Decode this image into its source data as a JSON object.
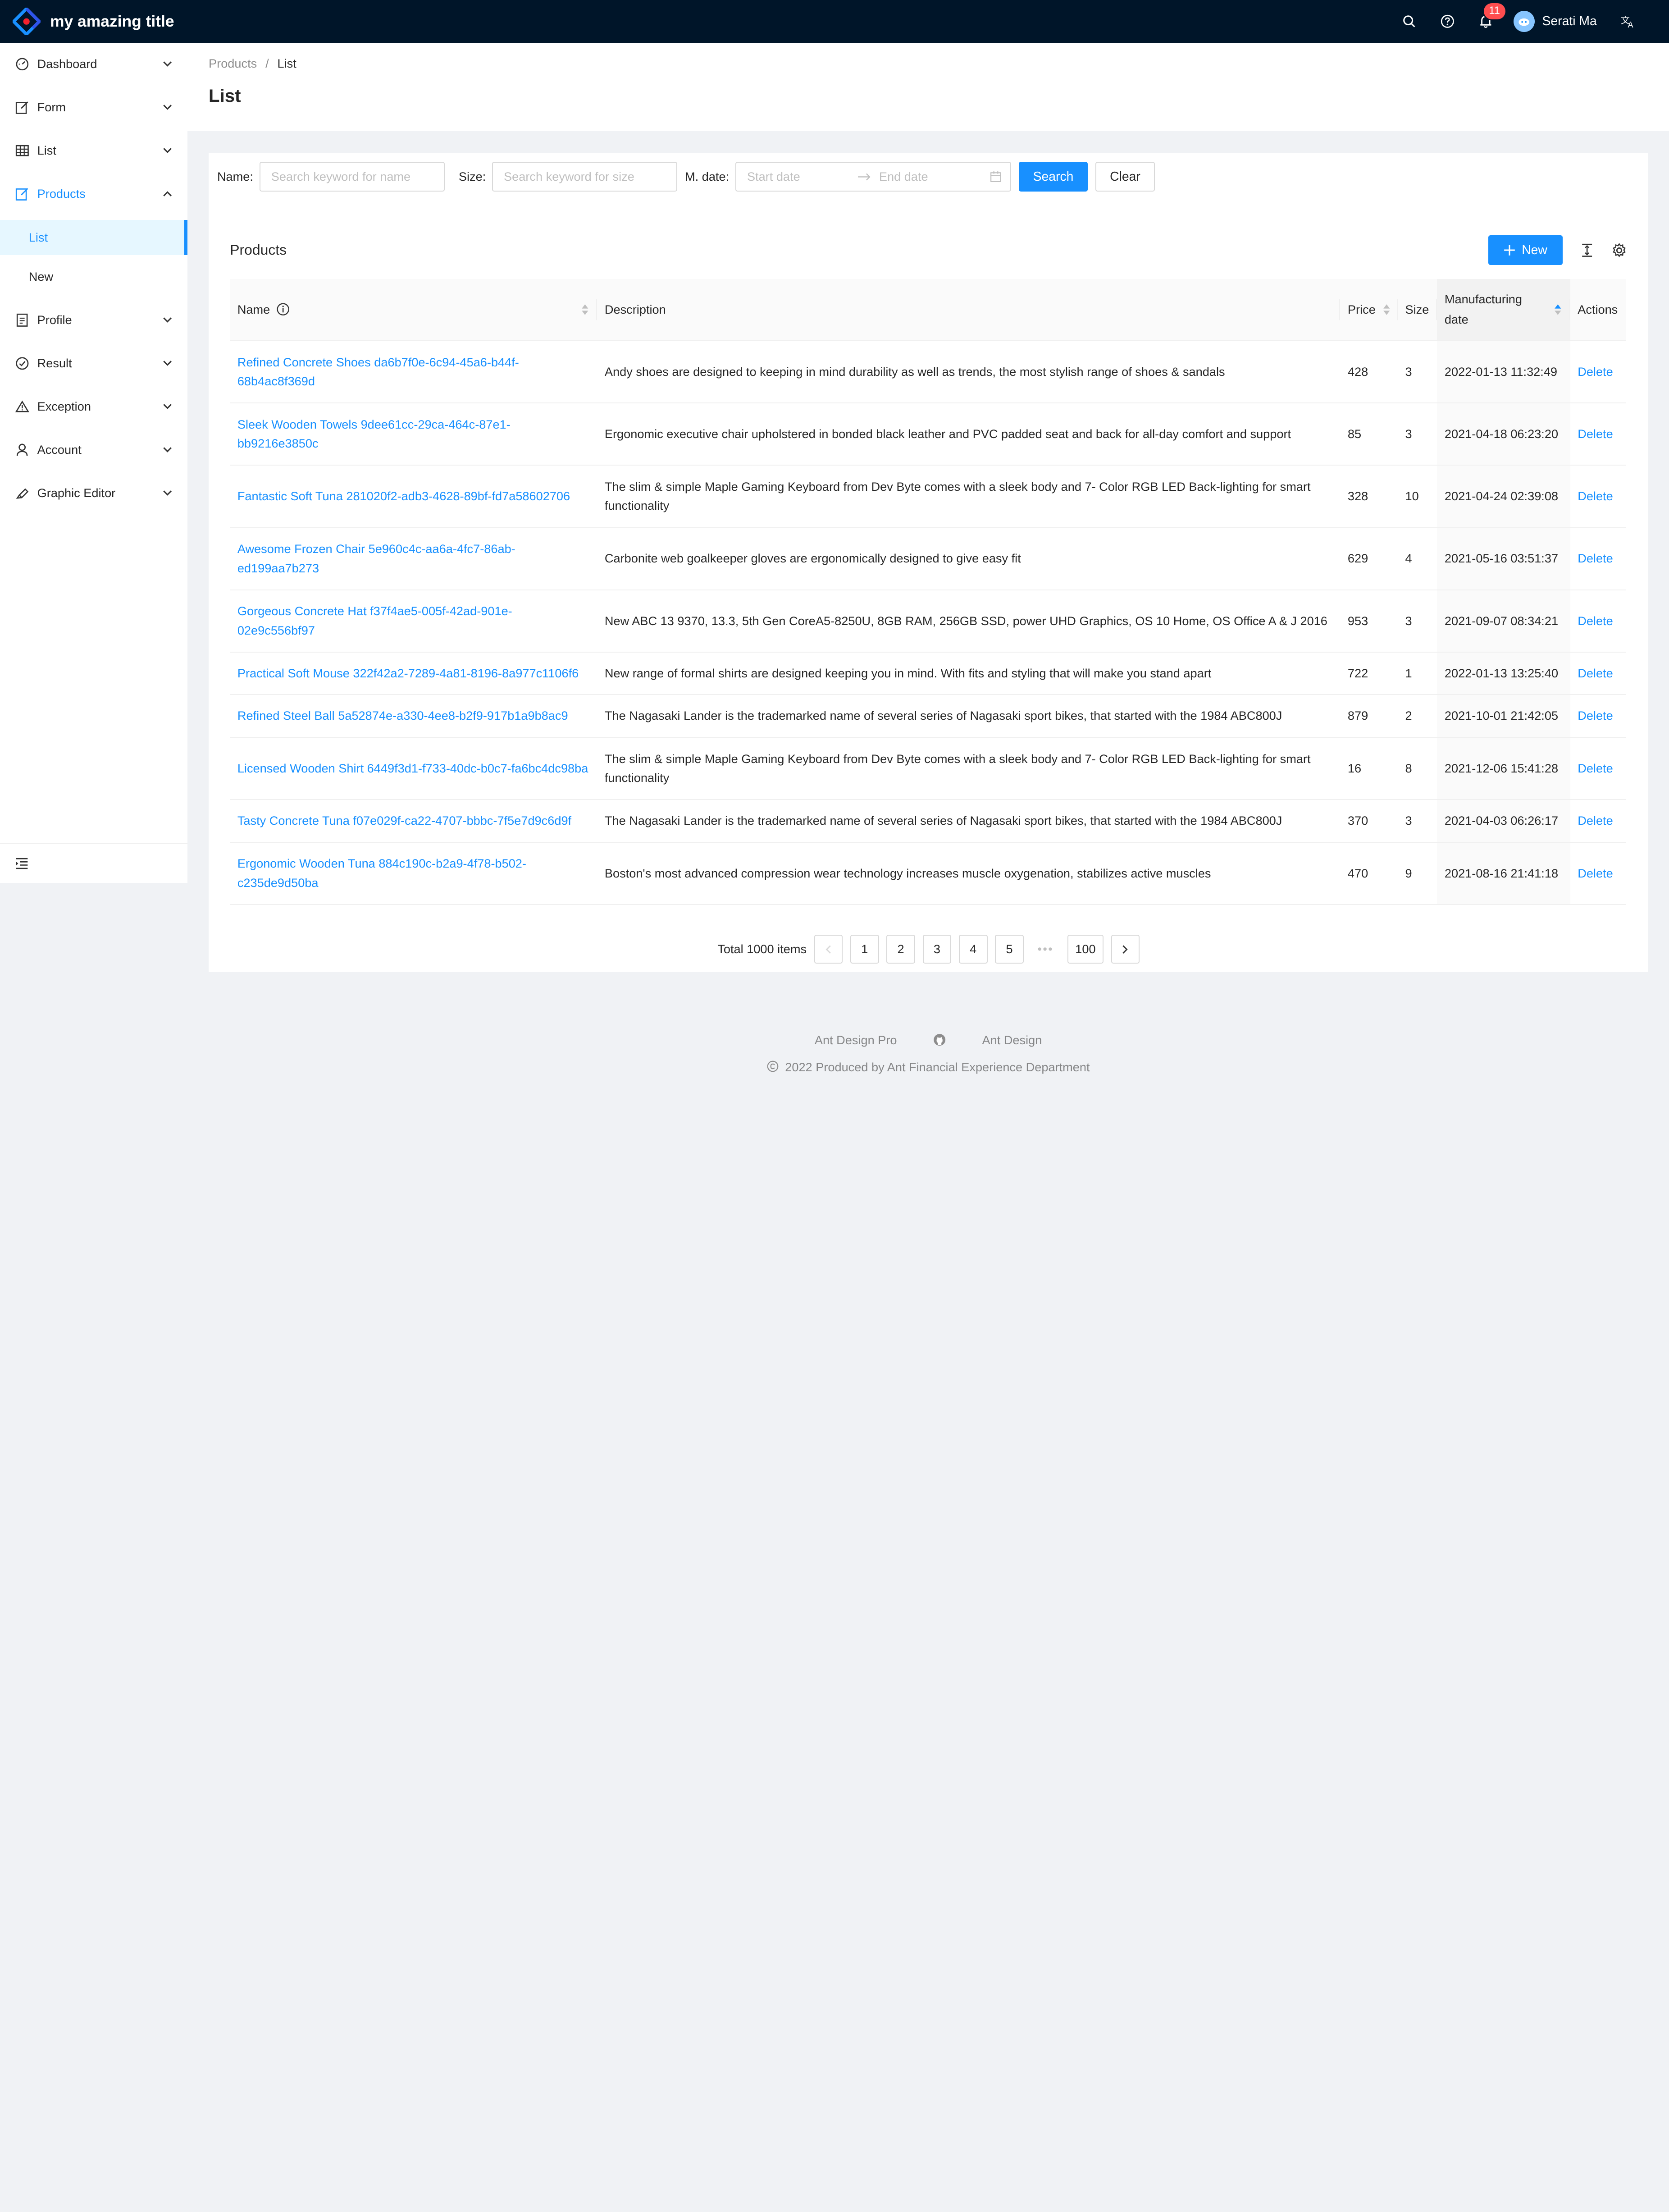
{
  "app": {
    "title": "my amazing title",
    "colors": {
      "header_bg": "#001529",
      "primary": "#1890ff",
      "badge": "#ff4d4f"
    }
  },
  "header": {
    "notifications_count": "11",
    "user_name": "Serati Ma",
    "icons": [
      "search-icon",
      "question-circle-icon",
      "bell-icon",
      "avatar",
      "translation-icon"
    ]
  },
  "sidebar": {
    "items": [
      {
        "label": "Dashboard",
        "icon": "dashboard-icon"
      },
      {
        "label": "Form",
        "icon": "form-icon"
      },
      {
        "label": "List",
        "icon": "table-icon"
      },
      {
        "label": "Products",
        "icon": "form-icon"
      },
      {
        "label": "Profile",
        "icon": "profile-icon"
      },
      {
        "label": "Result",
        "icon": "check-circle-icon"
      },
      {
        "label": "Exception",
        "icon": "warning-icon"
      },
      {
        "label": "Account",
        "icon": "user-icon"
      },
      {
        "label": "Graphic Editor",
        "icon": "highlight-icon"
      }
    ],
    "products_sub": [
      {
        "label": "List"
      },
      {
        "label": "New"
      }
    ]
  },
  "breadcrumb": {
    "parent": "Products",
    "sep": "/",
    "current": "List"
  },
  "page": {
    "title": "List"
  },
  "search": {
    "name_label": "Name",
    "name_placeholder": "Search keyword for name",
    "size_label": "Size",
    "size_placeholder": "Search keyword for size",
    "date_label": "M. date",
    "start_placeholder": "Start date",
    "end_placeholder": "End date",
    "search_label": "Search",
    "clear_label": "Clear"
  },
  "table": {
    "title": "Products",
    "new_label": "New",
    "columns": {
      "name": "Name",
      "description": "Description",
      "price": "Price",
      "size": "Size",
      "date_line1": "Manufacturing",
      "date_line2": "date",
      "actions": "Actions"
    },
    "rows": [
      {
        "name": "Refined Concrete Shoes da6b7f0e-6c94-45a6-b44f-68b4ac8f369d",
        "description": "Andy shoes are designed to keeping in mind durability as well as trends, the most stylish range of shoes & sandals",
        "price": "428",
        "size": "3",
        "date": "2022-01-13 11:32:49",
        "action": "Delete"
      },
      {
        "name": "Sleek Wooden Towels 9dee61cc-29ca-464c-87e1-bb9216e3850c",
        "description": "Ergonomic executive chair upholstered in bonded black leather and PVC padded seat and back for all-day comfort and support",
        "price": "85",
        "size": "3",
        "date": "2021-04-18 06:23:20",
        "action": "Delete"
      },
      {
        "name": "Fantastic Soft Tuna 281020f2-adb3-4628-89bf-fd7a58602706",
        "description": "The slim & simple Maple Gaming Keyboard from Dev Byte comes with a sleek body and 7- Color RGB LED Back-lighting for smart functionality",
        "price": "328",
        "size": "10",
        "date": "2021-04-24 02:39:08",
        "action": "Delete"
      },
      {
        "name": "Awesome Frozen Chair 5e960c4c-aa6a-4fc7-86ab-ed199aa7b273",
        "description": "Carbonite web goalkeeper gloves are ergonomically designed to give easy fit",
        "price": "629",
        "size": "4",
        "date": "2021-05-16 03:51:37",
        "action": "Delete"
      },
      {
        "name": "Gorgeous Concrete Hat f37f4ae5-005f-42ad-901e-02e9c556bf97",
        "description": "New ABC 13 9370, 13.3, 5th Gen CoreA5-8250U, 8GB RAM, 256GB SSD, power UHD Graphics, OS 10 Home, OS Office A & J 2016",
        "price": "953",
        "size": "3",
        "date": "2021-09-07 08:34:21",
        "action": "Delete"
      },
      {
        "name": "Practical Soft Mouse 322f42a2-7289-4a81-8196-8a977c1106f6",
        "description": "New range of formal shirts are designed keeping you in mind. With fits and styling that will make you stand apart",
        "price": "722",
        "size": "1",
        "date": "2022-01-13 13:25:40",
        "action": "Delete"
      },
      {
        "name": "Refined Steel Ball 5a52874e-a330-4ee8-b2f9-917b1a9b8ac9",
        "description": "The Nagasaki Lander is the trademarked name of several series of Nagasaki sport bikes, that started with the 1984 ABC800J",
        "price": "879",
        "size": "2",
        "date": "2021-10-01 21:42:05",
        "action": "Delete"
      },
      {
        "name": "Licensed Wooden Shirt 6449f3d1-f733-40dc-b0c7-fa6bc4dc98ba",
        "description": "The slim & simple Maple Gaming Keyboard from Dev Byte comes with a sleek body and 7- Color RGB LED Back-lighting for smart functionality",
        "price": "16",
        "size": "8",
        "date": "2021-12-06 15:41:28",
        "action": "Delete"
      },
      {
        "name": "Tasty Concrete Tuna f07e029f-ca22-4707-bbbc-7f5e7d9c6d9f",
        "description": "The Nagasaki Lander is the trademarked name of several series of Nagasaki sport bikes, that started with the 1984 ABC800J",
        "price": "370",
        "size": "3",
        "date": "2021-04-03 06:26:17",
        "action": "Delete"
      },
      {
        "name": "Ergonomic Wooden Tuna 884c190c-b2a9-4f78-b502-c235de9d50ba",
        "description": "Boston's most advanced compression wear technology increases muscle oxygenation, stabilizes active muscles",
        "price": "470",
        "size": "9",
        "date": "2021-08-16 21:41:18",
        "action": "Delete"
      }
    ]
  },
  "pagination": {
    "total": "Total 1000 items",
    "pages": [
      "1",
      "2",
      "3",
      "4",
      "5"
    ],
    "dots": "•••",
    "last": "100",
    "current": "1"
  },
  "footer": {
    "link1": "Ant Design Pro",
    "link2": "Ant Design",
    "copyright": "2022 Produced by Ant Financial Experience Department"
  }
}
